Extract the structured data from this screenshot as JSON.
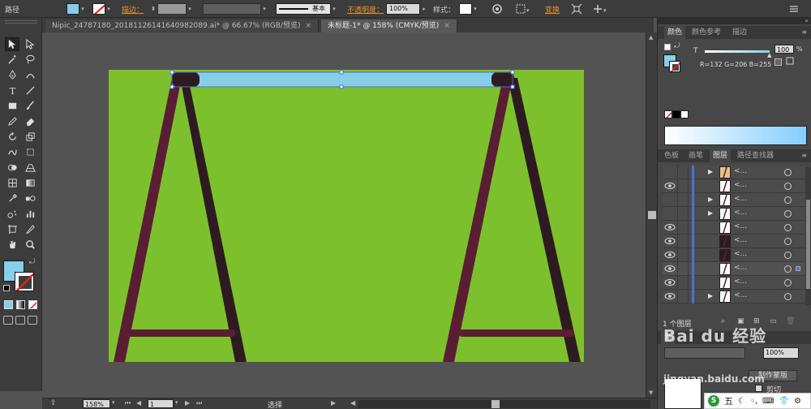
{
  "control_bar": {
    "selection_type": "路径",
    "fill_color": "#87CEEB",
    "stroke_label": "描边：",
    "stroke_profile_label": "基本",
    "opacity_label": "不透明度：",
    "opacity_value": "100%",
    "style_label": "样式：",
    "transform_label": "变换"
  },
  "tabs": [
    {
      "label": "Nipic_24787180_20181126141640982089.ai* @ 66.67% (RGB/预览)",
      "close": "×"
    },
    {
      "label": "未标题-1* @ 158% (CMYK/预览)",
      "close": "×"
    }
  ],
  "toolbar": {
    "fill_color": "#87CEEB",
    "stroke_color": "#FFFFFF",
    "tools": [
      "selection-tool",
      "direct-selection-tool",
      "magic-wand-tool",
      "lasso-tool",
      "pen-tool",
      "curvature-tool",
      "type-tool",
      "line-tool",
      "rectangle-tool",
      "paintbrush-tool",
      "pencil-tool",
      "eraser-tool",
      "rotate-tool",
      "scale-tool",
      "warp-tool",
      "free-transform-tool",
      "shape-builder-tool",
      "perspective-grid-tool",
      "mesh-tool",
      "gradient-tool",
      "eyedropper-tool",
      "blend-tool",
      "symbol-sprayer-tool",
      "column-graph-tool",
      "artboard-tool",
      "slice-tool",
      "hand-tool",
      "zoom-tool"
    ]
  },
  "artwork": {
    "background_color": "#7CC12D",
    "bar_color": "#87CEEB",
    "cap_color": "#2E1B22",
    "front_leg_color": "#5A1E34",
    "back_leg_color": "#2E1B22",
    "crossbar_color": "#5A1E34"
  },
  "color_panel": {
    "tabs": [
      "颜色",
      "颜色参考",
      "描边"
    ],
    "active_tab": "颜色",
    "tint_label": "T",
    "tint_value": "100",
    "tint_unit": "%",
    "rgb_readout": "R=132 G=206 B=255",
    "color": "#84CEFF"
  },
  "layers_panel": {
    "tabs": [
      "色板",
      "画笔",
      "图层",
      "路径查找器"
    ],
    "active_tab": "图层",
    "rows": [
      {
        "name": "<...",
        "visible": false,
        "expandable": true,
        "selected": false
      },
      {
        "name": "<...",
        "visible": true,
        "expandable": false,
        "selected": false
      },
      {
        "name": "<...",
        "visible": false,
        "expandable": true,
        "selected": false
      },
      {
        "name": "<...",
        "visible": false,
        "expandable": true,
        "selected": false
      },
      {
        "name": "<...",
        "visible": true,
        "expandable": false,
        "selected": false
      },
      {
        "name": "<...",
        "visible": true,
        "expandable": false,
        "selected": false
      },
      {
        "name": "<...",
        "visible": true,
        "expandable": false,
        "selected": false
      },
      {
        "name": "<...",
        "visible": true,
        "expandable": false,
        "selected": true
      },
      {
        "name": "<...",
        "visible": true,
        "expandable": false,
        "selected": false
      },
      {
        "name": "<...",
        "visible": true,
        "expandable": true,
        "selected": false
      }
    ],
    "layer_count": "1 个图层",
    "transparency_value": "100%",
    "make_mask_label": "制作蒙版",
    "clip_label": "剪切",
    "partial_tab_label": "渐"
  },
  "status_bar": {
    "zoom": "158%",
    "artboard_number": "1",
    "tool_status": "选择"
  },
  "watermark": {
    "site": "Bai du 经验",
    "url": "jingyan.baidu.com"
  }
}
